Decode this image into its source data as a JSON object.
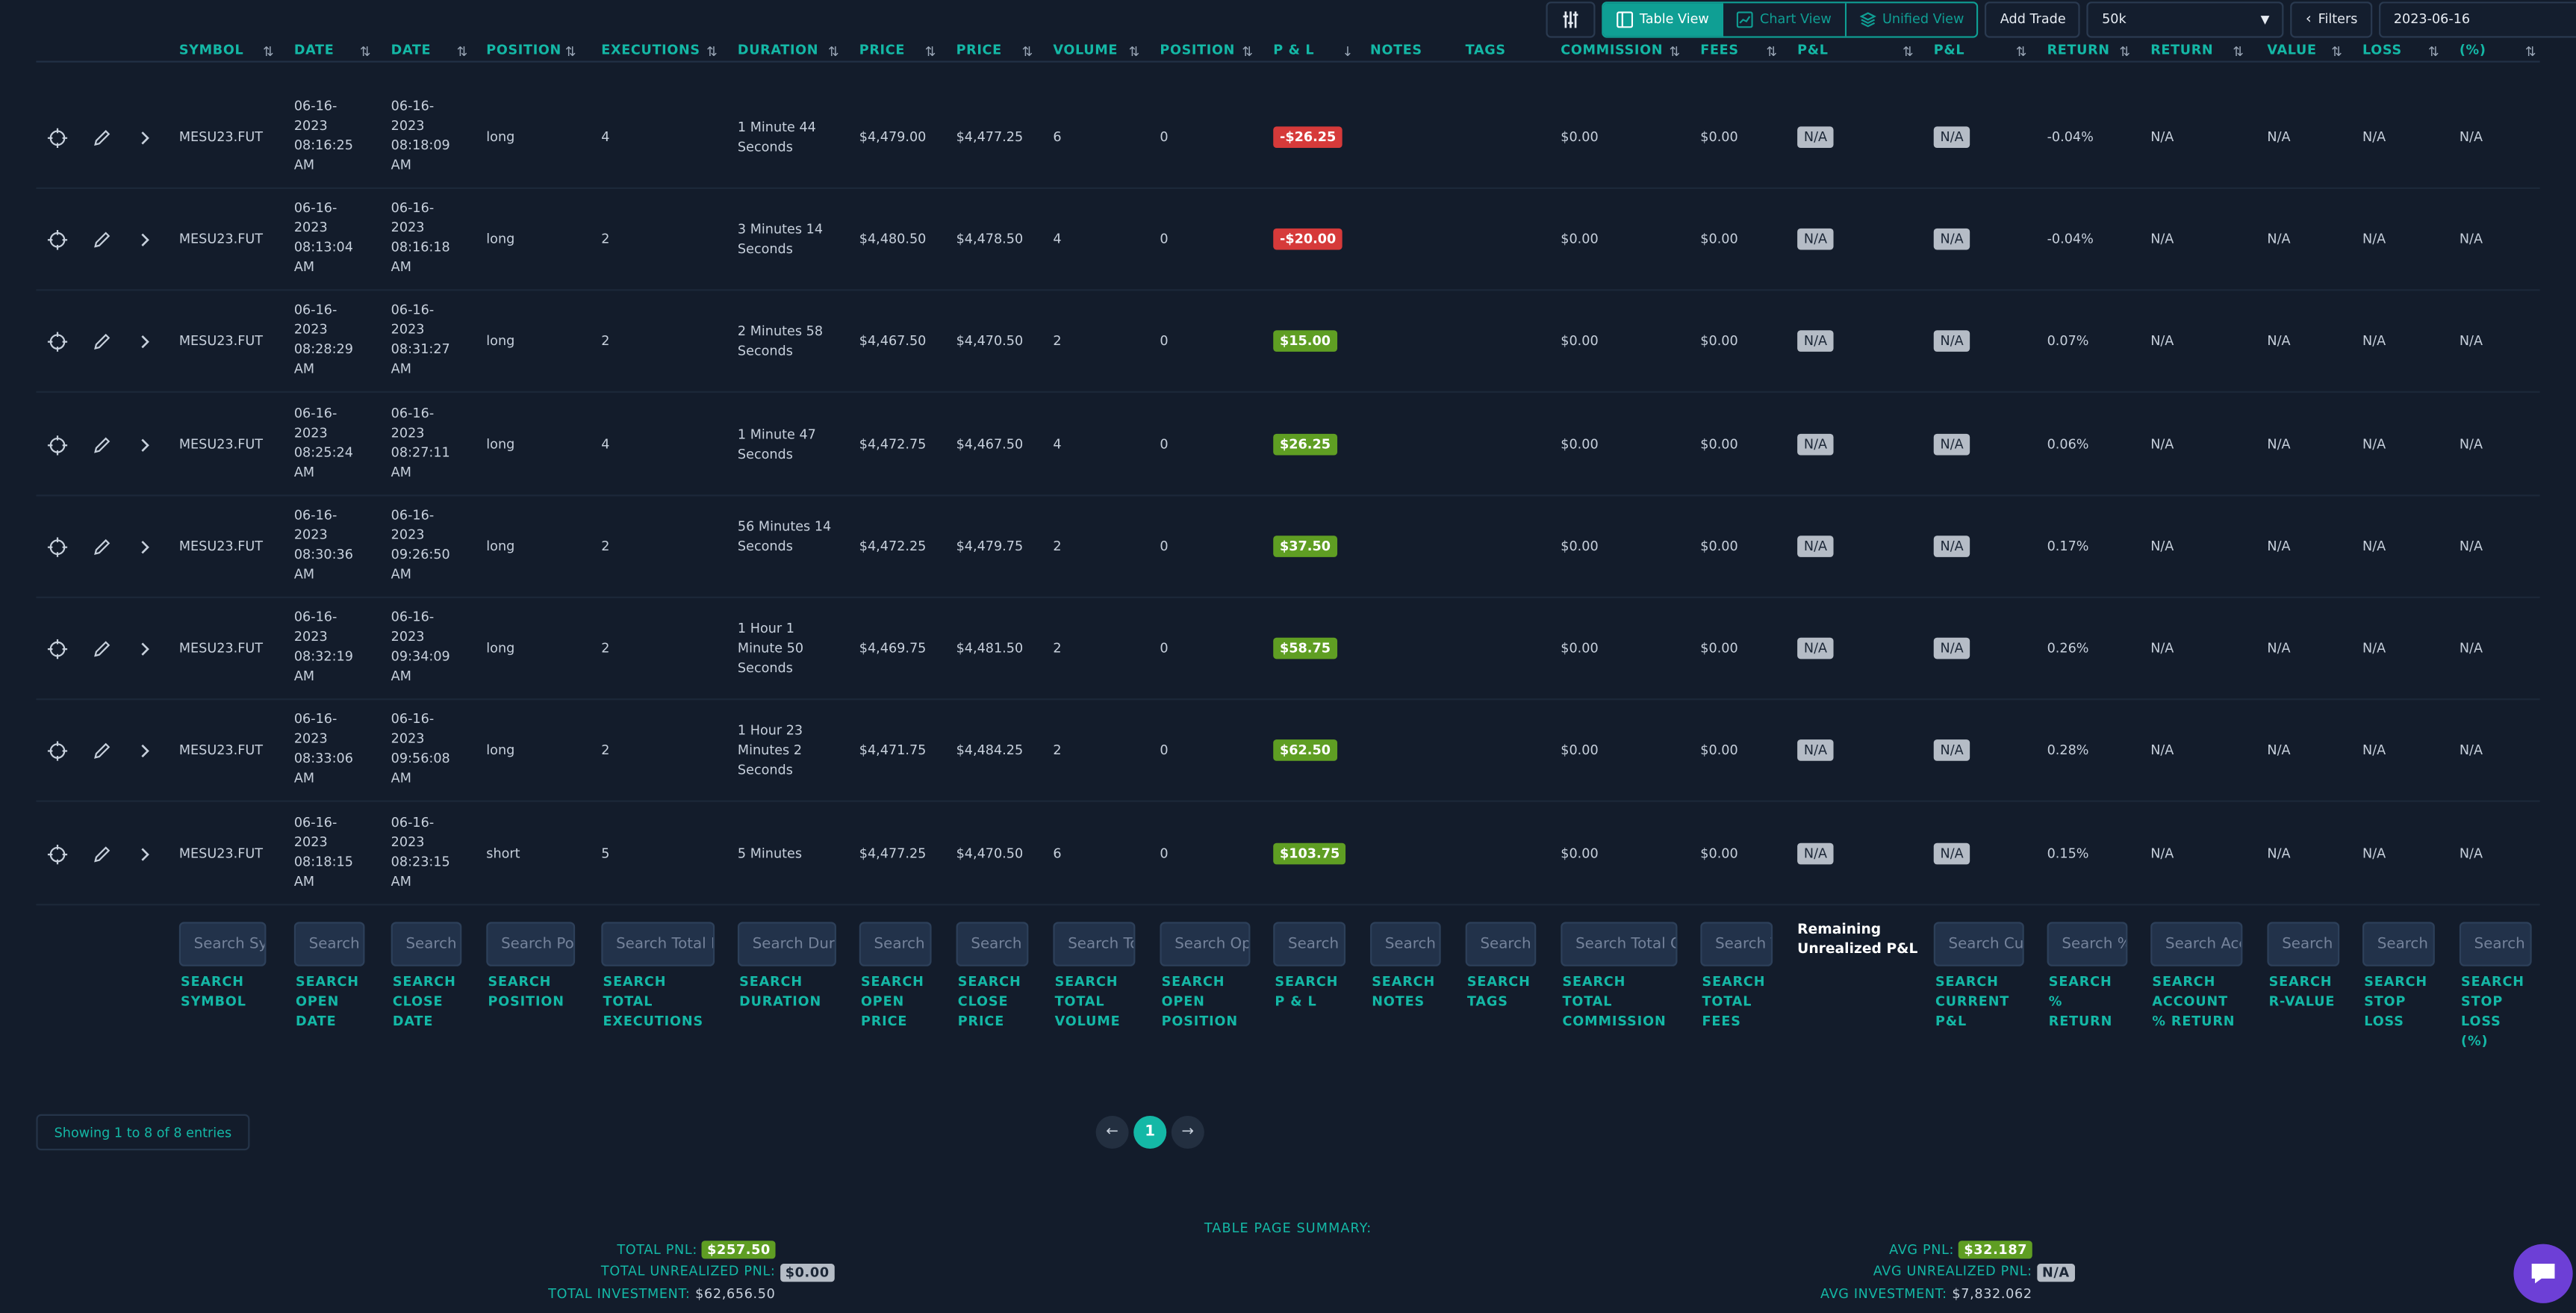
{
  "toolbar": {
    "table_view": "Table View",
    "chart_view": "Chart View",
    "unified_view": "Unified View",
    "add_trade": "Add Trade",
    "account_select": "50k",
    "filters": "Filters",
    "date": "2023-06-16"
  },
  "headers": [
    "SYMBOL",
    "DATE",
    "DATE",
    "POSITION",
    "EXECUTIONS",
    "DURATION",
    "PRICE",
    "PRICE",
    "VOLUME",
    "POSITION",
    "P & L",
    "NOTES",
    "TAGS",
    "COMMISSION",
    "FEES",
    "P&L",
    "P&L",
    "RETURN",
    "RETURN",
    "VALUE",
    "LOSS",
    "(%)"
  ],
  "rows": [
    {
      "symbol": "MESU23.FUT",
      "open": "06-16-2023 08:16:25 AM",
      "close": "06-16-2023 08:18:09 AM",
      "position": "long",
      "executions": "4",
      "duration": "1 Minute 44 Seconds",
      "open_price": "$4,479.00",
      "close_price": "$4,477.25",
      "volume": "6",
      "open_position": "0",
      "pnl": "-$26.25",
      "pnl_sign": "neg",
      "notes": "",
      "tags": "",
      "commission": "$0.00",
      "fees": "$0.00",
      "unrealized": "N/A",
      "current": "N/A",
      "ret": "-0.04%",
      "acct_ret": "N/A",
      "rvalue": "N/A",
      "stop": "N/A",
      "stop_pct": "N/A"
    },
    {
      "symbol": "MESU23.FUT",
      "open": "06-16-2023 08:13:04 AM",
      "close": "06-16-2023 08:16:18 AM",
      "position": "long",
      "executions": "2",
      "duration": "3 Minutes 14 Seconds",
      "open_price": "$4,480.50",
      "close_price": "$4,478.50",
      "volume": "4",
      "open_position": "0",
      "pnl": "-$20.00",
      "pnl_sign": "neg",
      "notes": "",
      "tags": "",
      "commission": "$0.00",
      "fees": "$0.00",
      "unrealized": "N/A",
      "current": "N/A",
      "ret": "-0.04%",
      "acct_ret": "N/A",
      "rvalue": "N/A",
      "stop": "N/A",
      "stop_pct": "N/A"
    },
    {
      "symbol": "MESU23.FUT",
      "open": "06-16-2023 08:28:29 AM",
      "close": "06-16-2023 08:31:27 AM",
      "position": "long",
      "executions": "2",
      "duration": "2 Minutes 58 Seconds",
      "open_price": "$4,467.50",
      "close_price": "$4,470.50",
      "volume": "2",
      "open_position": "0",
      "pnl": "$15.00",
      "pnl_sign": "pos",
      "notes": "",
      "tags": "",
      "commission": "$0.00",
      "fees": "$0.00",
      "unrealized": "N/A",
      "current": "N/A",
      "ret": "0.07%",
      "acct_ret": "N/A",
      "rvalue": "N/A",
      "stop": "N/A",
      "stop_pct": "N/A"
    },
    {
      "symbol": "MESU23.FUT",
      "open": "06-16-2023 08:25:24 AM",
      "close": "06-16-2023 08:27:11 AM",
      "position": "long",
      "executions": "4",
      "duration": "1 Minute 47 Seconds",
      "open_price": "$4,472.75",
      "close_price": "$4,467.50",
      "volume": "4",
      "open_position": "0",
      "pnl": "$26.25",
      "pnl_sign": "pos",
      "notes": "",
      "tags": "",
      "commission": "$0.00",
      "fees": "$0.00",
      "unrealized": "N/A",
      "current": "N/A",
      "ret": "0.06%",
      "acct_ret": "N/A",
      "rvalue": "N/A",
      "stop": "N/A",
      "stop_pct": "N/A"
    },
    {
      "symbol": "MESU23.FUT",
      "open": "06-16-2023 08:30:36 AM",
      "close": "06-16-2023 09:26:50 AM",
      "position": "long",
      "executions": "2",
      "duration": "56 Minutes 14 Seconds",
      "open_price": "$4,472.25",
      "close_price": "$4,479.75",
      "volume": "2",
      "open_position": "0",
      "pnl": "$37.50",
      "pnl_sign": "pos",
      "notes": "",
      "tags": "",
      "commission": "$0.00",
      "fees": "$0.00",
      "unrealized": "N/A",
      "current": "N/A",
      "ret": "0.17%",
      "acct_ret": "N/A",
      "rvalue": "N/A",
      "stop": "N/A",
      "stop_pct": "N/A"
    },
    {
      "symbol": "MESU23.FUT",
      "open": "06-16-2023 08:32:19 AM",
      "close": "06-16-2023 09:34:09 AM",
      "position": "long",
      "executions": "2",
      "duration": "1 Hour 1 Minute 50 Seconds",
      "open_price": "$4,469.75",
      "close_price": "$4,481.50",
      "volume": "2",
      "open_position": "0",
      "pnl": "$58.75",
      "pnl_sign": "pos",
      "notes": "",
      "tags": "",
      "commission": "$0.00",
      "fees": "$0.00",
      "unrealized": "N/A",
      "current": "N/A",
      "ret": "0.26%",
      "acct_ret": "N/A",
      "rvalue": "N/A",
      "stop": "N/A",
      "stop_pct": "N/A"
    },
    {
      "symbol": "MESU23.FUT",
      "open": "06-16-2023 08:33:06 AM",
      "close": "06-16-2023 09:56:08 AM",
      "position": "long",
      "executions": "2",
      "duration": "1 Hour 23 Minutes 2 Seconds",
      "open_price": "$4,471.75",
      "close_price": "$4,484.25",
      "volume": "2",
      "open_position": "0",
      "pnl": "$62.50",
      "pnl_sign": "pos",
      "notes": "",
      "tags": "",
      "commission": "$0.00",
      "fees": "$0.00",
      "unrealized": "N/A",
      "current": "N/A",
      "ret": "0.28%",
      "acct_ret": "N/A",
      "rvalue": "N/A",
      "stop": "N/A",
      "stop_pct": "N/A"
    },
    {
      "symbol": "MESU23.FUT",
      "open": "06-16-2023 08:18:15 AM",
      "close": "06-16-2023 08:23:15 AM",
      "position": "short",
      "executions": "5",
      "duration": "5 Minutes",
      "open_price": "$4,477.25",
      "close_price": "$4,470.50",
      "volume": "6",
      "open_position": "0",
      "pnl": "$103.75",
      "pnl_sign": "pos",
      "notes": "",
      "tags": "",
      "commission": "$0.00",
      "fees": "$0.00",
      "unrealized": "N/A",
      "current": "N/A",
      "ret": "0.15%",
      "acct_ret": "N/A",
      "rvalue": "N/A",
      "stop": "N/A",
      "stop_pct": "N/A"
    }
  ],
  "search": [
    {
      "placeholder": "Search Symbol",
      "label": "SEARCH\nSYMBOL"
    },
    {
      "placeholder": "Search Open Date",
      "label": "SEARCH\nOPEN\nDATE"
    },
    {
      "placeholder": "Search Close Date",
      "label": "SEARCH\nCLOSE\nDATE"
    },
    {
      "placeholder": "Search Position",
      "label": "SEARCH\nPOSITION"
    },
    {
      "placeholder": "Search Total Executions",
      "label": "SEARCH\nTOTAL\nEXECUTIONS"
    },
    {
      "placeholder": "Search Duration",
      "label": "SEARCH\nDURATION"
    },
    {
      "placeholder": "Search Open Price",
      "label": "SEARCH\nOPEN\nPRICE"
    },
    {
      "placeholder": "Search Close Price",
      "label": "SEARCH\nCLOSE\nPRICE"
    },
    {
      "placeholder": "Search Total Volume",
      "label": "SEARCH\nTOTAL\nVOLUME"
    },
    {
      "placeholder": "Search Open Position",
      "label": "SEARCH\nOPEN\nPOSITION"
    },
    {
      "placeholder": "Search P & L",
      "label": "SEARCH\nP & L"
    },
    {
      "placeholder": "Search Notes",
      "label": "SEARCH\nNOTES"
    },
    {
      "placeholder": "Search Tags",
      "label": "SEARCH\nTAGS"
    },
    {
      "placeholder": "Search Total Commission",
      "label": "SEARCH\nTOTAL\nCOMMISSION"
    },
    {
      "placeholder": "Search Total Fees",
      "label": "SEARCH\nTOTAL\nFEES"
    },
    {
      "placeholder": "Search Current P&L",
      "label": "SEARCH\nCURRENT\nP&L"
    },
    {
      "placeholder": "Search % Return",
      "label": "SEARCH\n%\nRETURN"
    },
    {
      "placeholder": "Search Account % Return",
      "label": "SEARCH\nACCOUNT\n% RETURN"
    },
    {
      "placeholder": "Search R-Value",
      "label": "SEARCH\nR-VALUE"
    },
    {
      "placeholder": "Search Stop Loss",
      "label": "SEARCH\nSTOP\nLOSS"
    },
    {
      "placeholder": "Search Stop Loss (%)",
      "label": "SEARCH\nSTOP\nLOSS\n(%)"
    }
  ],
  "remaining_label": "Remaining Unrealized P&L",
  "pagination": {
    "entries": "Showing 1 to 8 of 8 entries",
    "current": "1"
  },
  "summary": {
    "title": "TABLE PAGE SUMMARY:",
    "left": [
      {
        "label": "TOTAL PNL:",
        "value": "$257.50",
        "style": "pos"
      },
      {
        "label": "TOTAL UNREALIZED PNL:",
        "value": "$0.00",
        "style": "na"
      },
      {
        "label": "TOTAL INVESTMENT:",
        "value": "$62,656.50",
        "style": "text"
      }
    ],
    "right": [
      {
        "label": "AVG PNL:",
        "value": "$32.187",
        "style": "pos"
      },
      {
        "label": "AVG UNREALIZED PNL:",
        "value": "N/A",
        "style": "na"
      },
      {
        "label": "AVG INVESTMENT:",
        "value": "$7,832.062",
        "style": "text"
      }
    ]
  },
  "colors": {
    "accent": "#14b8a6",
    "positive": "#5f9e23",
    "negative": "#d63a3a",
    "background": "#131c2b"
  }
}
